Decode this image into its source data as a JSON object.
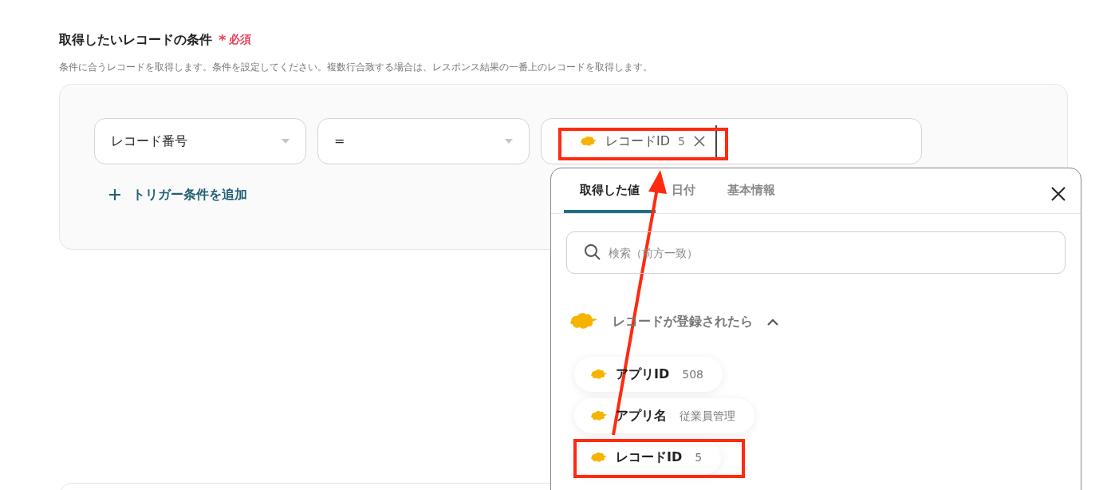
{
  "field": {
    "label": "取得したいレコードの条件",
    "required_mark": "*",
    "required_text": "必須",
    "description": "条件に合うレコードを取得します。条件を設定してください。複数行合致する場合は、レスポンス結果の一番上のレコードを取得します。"
  },
  "condition": {
    "field_select": "レコード番号",
    "operator_select": "=",
    "value_chips": [
      {
        "label": "レコードID",
        "value": "5"
      }
    ]
  },
  "add_button": "トリガー条件を追加",
  "picker": {
    "tabs": [
      {
        "label": "取得した値",
        "selected": true
      },
      {
        "label": "日付",
        "selected": false
      },
      {
        "label": "基本情報",
        "selected": false
      }
    ],
    "search": {
      "placeholder": "検索（前方一致）"
    },
    "group": {
      "title": "レコードが登録されたら",
      "expanded": true,
      "items": [
        {
          "label": "アプリID",
          "value": "508"
        },
        {
          "label": "アプリ名",
          "value": "従業員管理"
        },
        {
          "label": "レコードID",
          "value": "5"
        }
      ]
    }
  }
}
